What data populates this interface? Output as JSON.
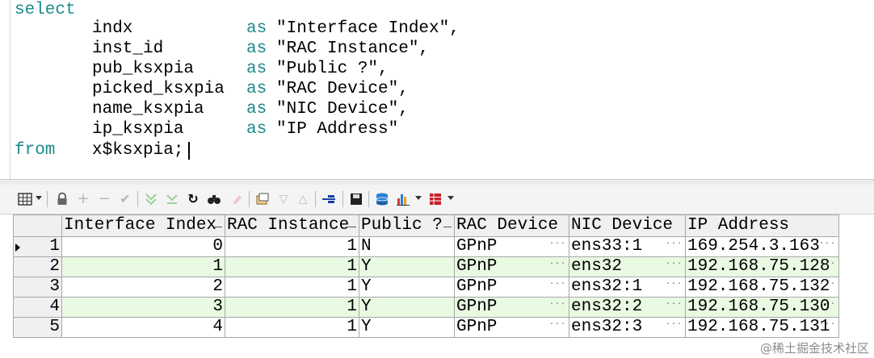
{
  "editor": {
    "lines": [
      {
        "kw": "select",
        "col": "",
        "as": "",
        "alias": ""
      },
      {
        "kw": "",
        "col": "indx",
        "as": "as",
        "alias": "\"Interface Index\","
      },
      {
        "kw": "",
        "col": "inst_id",
        "as": "as",
        "alias": "\"RAC Instance\","
      },
      {
        "kw": "",
        "col": "pub_ksxpia",
        "as": "as",
        "alias": "\"Public ?\","
      },
      {
        "kw": "",
        "col": "picked_ksxpia",
        "as": "as",
        "alias": "\"RAC Device\","
      },
      {
        "kw": "",
        "col": "name_ksxpia",
        "as": "as",
        "alias": "\"NIC Device\","
      },
      {
        "kw": "",
        "col": "ip_ksxpia",
        "as": "as",
        "alias": "\"IP Address\""
      },
      {
        "kw": "from",
        "col": "x$ksxpia;",
        "as": "",
        "alias": ""
      }
    ]
  },
  "toolbar": {
    "icons": [
      "grid-icon",
      "lock-icon",
      "add-icon",
      "remove-icon",
      "check-icon",
      "filter-icon",
      "filter-clear-icon",
      "refresh-icon",
      "find-icon",
      "clear-icon",
      "export-icon",
      "sort-desc-icon",
      "sort-asc-icon",
      "connect-icon",
      "save-icon",
      "database-icon",
      "chart-icon",
      "table-icon"
    ]
  },
  "grid": {
    "columns": [
      "Interface Index",
      "RAC Instance",
      "Public ?",
      "RAC Device",
      "NIC Device",
      "IP Address"
    ],
    "rows": [
      {
        "n": "1",
        "cells": [
          "0",
          "1",
          "N",
          "GPnP",
          "ens33:1",
          "169.254.3.163"
        ]
      },
      {
        "n": "2",
        "cells": [
          "1",
          "1",
          "Y",
          "GPnP",
          "ens32",
          "192.168.75.128"
        ]
      },
      {
        "n": "3",
        "cells": [
          "2",
          "1",
          "Y",
          "GPnP",
          "ens32:1",
          "192.168.75.132"
        ]
      },
      {
        "n": "4",
        "cells": [
          "3",
          "1",
          "Y",
          "GPnP",
          "ens32:2",
          "192.168.75.130"
        ]
      },
      {
        "n": "5",
        "cells": [
          "4",
          "1",
          "Y",
          "GPnP",
          "ens32:3",
          "192.168.75.131"
        ]
      }
    ]
  },
  "watermark": "@稀土掘金技术社区",
  "colors": {
    "keyword": "#1c8a8a",
    "row_alt": "#e9fae2"
  }
}
